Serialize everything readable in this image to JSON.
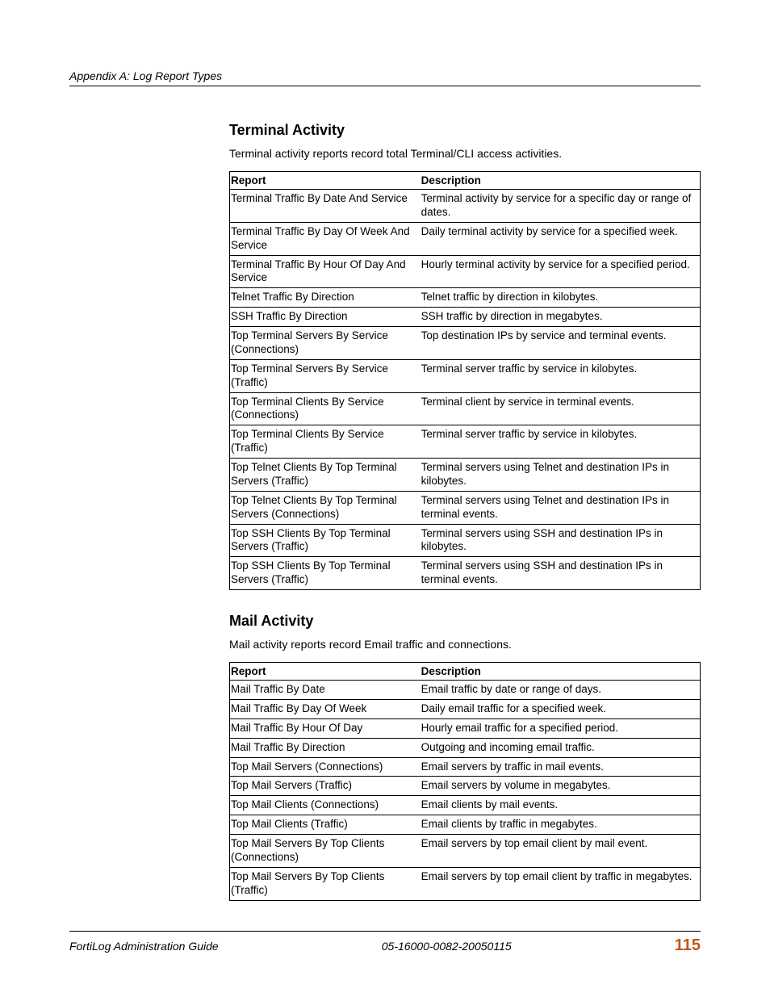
{
  "header": {
    "appendix": "Appendix A: Log Report Types"
  },
  "sections": {
    "terminal": {
      "heading": "Terminal Activity",
      "intro": "Terminal activity reports record total Terminal/CLI access activities.",
      "cols": {
        "report": "Report",
        "description": "Description"
      },
      "rows": [
        {
          "report": "Terminal Traffic By Date And Service",
          "description": "Terminal activity by service for a specific day or range of dates."
        },
        {
          "report": "Terminal Traffic By Day Of Week And Service",
          "description": "Daily terminal activity by service for a specified week."
        },
        {
          "report": "Terminal Traffic By Hour Of Day And Service",
          "description": "Hourly terminal activity by service for a specified period."
        },
        {
          "report": "Telnet Traffic By Direction",
          "description": "Telnet traffic by direction in kilobytes."
        },
        {
          "report": "SSH Traffic By Direction",
          "description": "SSH traffic by direction in megabytes."
        },
        {
          "report": "Top Terminal Servers By Service (Connections)",
          "description": "Top destination IPs by service and terminal events."
        },
        {
          "report": "Top Terminal Servers By Service (Traffic)",
          "description": "Terminal server traffic by service in kilobytes."
        },
        {
          "report": "Top Terminal Clients By Service (Connections)",
          "description": "Terminal client by service in terminal events."
        },
        {
          "report": "Top Terminal Clients By Service (Traffic)",
          "description": "Terminal server traffic by service in kilobytes."
        },
        {
          "report": "Top Telnet Clients By Top Terminal Servers (Traffic)",
          "description": "Terminal servers using Telnet and destination IPs in kilobytes."
        },
        {
          "report": "Top Telnet Clients By Top Terminal Servers (Connections)",
          "description": "Terminal servers using Telnet and destination IPs in terminal events."
        },
        {
          "report": "Top SSH Clients By Top Terminal Servers (Traffic)",
          "description": "Terminal servers using SSH and destination IPs in kilobytes."
        },
        {
          "report": "Top SSH Clients By Top Terminal Servers (Traffic)",
          "description": "Terminal servers using SSH and destination IPs in terminal events."
        }
      ]
    },
    "mail": {
      "heading": "Mail Activity",
      "intro": "Mail activity reports record Email traffic and connections.",
      "cols": {
        "report": "Report",
        "description": "Description"
      },
      "rows": [
        {
          "report": "Mail Traffic By Date",
          "description": "Email traffic by date or range of days."
        },
        {
          "report": "Mail Traffic By Day Of Week",
          "description": "Daily email traffic for a specified week."
        },
        {
          "report": "Mail Traffic By Hour Of Day",
          "description": "Hourly email traffic for a specified period."
        },
        {
          "report": "Mail Traffic By Direction",
          "description": "Outgoing and incoming email traffic."
        },
        {
          "report": "Top Mail Servers (Connections)",
          "description": "Email servers by traffic in mail events."
        },
        {
          "report": "Top Mail Servers (Traffic)",
          "description": "Email servers by volume in megabytes."
        },
        {
          "report": "Top Mail Clients (Connections)",
          "description": "Email clients by mail events."
        },
        {
          "report": "Top Mail Clients (Traffic)",
          "description": "Email clients by traffic in megabytes."
        },
        {
          "report": "Top Mail Servers By Top Clients (Connections)",
          "description": "Email servers by top email client by mail event."
        },
        {
          "report": "Top Mail Servers By Top Clients (Traffic)",
          "description": "Email servers by top email client by traffic in megabytes."
        }
      ]
    }
  },
  "footer": {
    "left": "FortiLog Administration Guide",
    "center": "05-16000-0082-20050115",
    "page": "115"
  }
}
